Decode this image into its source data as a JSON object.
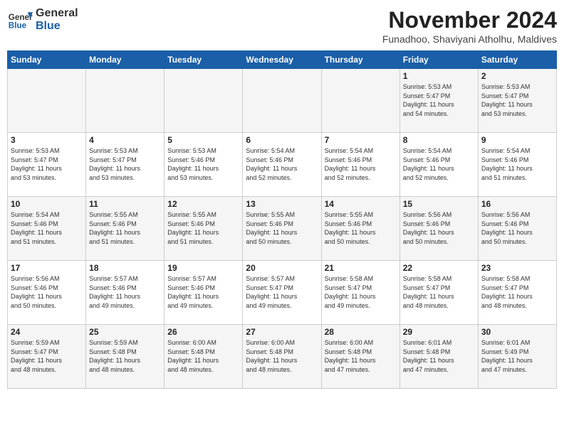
{
  "header": {
    "logo": {
      "general": "General",
      "blue": "Blue"
    },
    "month": "November 2024",
    "location": "Funadhoo, Shaviyani Atholhu, Maldives"
  },
  "days_of_week": [
    "Sunday",
    "Monday",
    "Tuesday",
    "Wednesday",
    "Thursday",
    "Friday",
    "Saturday"
  ],
  "weeks": [
    [
      {
        "day": "",
        "info": ""
      },
      {
        "day": "",
        "info": ""
      },
      {
        "day": "",
        "info": ""
      },
      {
        "day": "",
        "info": ""
      },
      {
        "day": "",
        "info": ""
      },
      {
        "day": "1",
        "info": "Sunrise: 5:53 AM\nSunset: 5:47 PM\nDaylight: 11 hours\nand 54 minutes."
      },
      {
        "day": "2",
        "info": "Sunrise: 5:53 AM\nSunset: 5:47 PM\nDaylight: 11 hours\nand 53 minutes."
      }
    ],
    [
      {
        "day": "3",
        "info": "Sunrise: 5:53 AM\nSunset: 5:47 PM\nDaylight: 11 hours\nand 53 minutes."
      },
      {
        "day": "4",
        "info": "Sunrise: 5:53 AM\nSunset: 5:47 PM\nDaylight: 11 hours\nand 53 minutes."
      },
      {
        "day": "5",
        "info": "Sunrise: 5:53 AM\nSunset: 5:46 PM\nDaylight: 11 hours\nand 53 minutes."
      },
      {
        "day": "6",
        "info": "Sunrise: 5:54 AM\nSunset: 5:46 PM\nDaylight: 11 hours\nand 52 minutes."
      },
      {
        "day": "7",
        "info": "Sunrise: 5:54 AM\nSunset: 5:46 PM\nDaylight: 11 hours\nand 52 minutes."
      },
      {
        "day": "8",
        "info": "Sunrise: 5:54 AM\nSunset: 5:46 PM\nDaylight: 11 hours\nand 52 minutes."
      },
      {
        "day": "9",
        "info": "Sunrise: 5:54 AM\nSunset: 5:46 PM\nDaylight: 11 hours\nand 51 minutes."
      }
    ],
    [
      {
        "day": "10",
        "info": "Sunrise: 5:54 AM\nSunset: 5:46 PM\nDaylight: 11 hours\nand 51 minutes."
      },
      {
        "day": "11",
        "info": "Sunrise: 5:55 AM\nSunset: 5:46 PM\nDaylight: 11 hours\nand 51 minutes."
      },
      {
        "day": "12",
        "info": "Sunrise: 5:55 AM\nSunset: 5:46 PM\nDaylight: 11 hours\nand 51 minutes."
      },
      {
        "day": "13",
        "info": "Sunrise: 5:55 AM\nSunset: 5:46 PM\nDaylight: 11 hours\nand 50 minutes."
      },
      {
        "day": "14",
        "info": "Sunrise: 5:55 AM\nSunset: 5:46 PM\nDaylight: 11 hours\nand 50 minutes."
      },
      {
        "day": "15",
        "info": "Sunrise: 5:56 AM\nSunset: 5:46 PM\nDaylight: 11 hours\nand 50 minutes."
      },
      {
        "day": "16",
        "info": "Sunrise: 5:56 AM\nSunset: 5:46 PM\nDaylight: 11 hours\nand 50 minutes."
      }
    ],
    [
      {
        "day": "17",
        "info": "Sunrise: 5:56 AM\nSunset: 5:46 PM\nDaylight: 11 hours\nand 50 minutes."
      },
      {
        "day": "18",
        "info": "Sunrise: 5:57 AM\nSunset: 5:46 PM\nDaylight: 11 hours\nand 49 minutes."
      },
      {
        "day": "19",
        "info": "Sunrise: 5:57 AM\nSunset: 5:46 PM\nDaylight: 11 hours\nand 49 minutes."
      },
      {
        "day": "20",
        "info": "Sunrise: 5:57 AM\nSunset: 5:47 PM\nDaylight: 11 hours\nand 49 minutes."
      },
      {
        "day": "21",
        "info": "Sunrise: 5:58 AM\nSunset: 5:47 PM\nDaylight: 11 hours\nand 49 minutes."
      },
      {
        "day": "22",
        "info": "Sunrise: 5:58 AM\nSunset: 5:47 PM\nDaylight: 11 hours\nand 48 minutes."
      },
      {
        "day": "23",
        "info": "Sunrise: 5:58 AM\nSunset: 5:47 PM\nDaylight: 11 hours\nand 48 minutes."
      }
    ],
    [
      {
        "day": "24",
        "info": "Sunrise: 5:59 AM\nSunset: 5:47 PM\nDaylight: 11 hours\nand 48 minutes."
      },
      {
        "day": "25",
        "info": "Sunrise: 5:59 AM\nSunset: 5:48 PM\nDaylight: 11 hours\nand 48 minutes."
      },
      {
        "day": "26",
        "info": "Sunrise: 6:00 AM\nSunset: 5:48 PM\nDaylight: 11 hours\nand 48 minutes."
      },
      {
        "day": "27",
        "info": "Sunrise: 6:00 AM\nSunset: 5:48 PM\nDaylight: 11 hours\nand 48 minutes."
      },
      {
        "day": "28",
        "info": "Sunrise: 6:00 AM\nSunset: 5:48 PM\nDaylight: 11 hours\nand 47 minutes."
      },
      {
        "day": "29",
        "info": "Sunrise: 6:01 AM\nSunset: 5:48 PM\nDaylight: 11 hours\nand 47 minutes."
      },
      {
        "day": "30",
        "info": "Sunrise: 6:01 AM\nSunset: 5:49 PM\nDaylight: 11 hours\nand 47 minutes."
      }
    ]
  ]
}
